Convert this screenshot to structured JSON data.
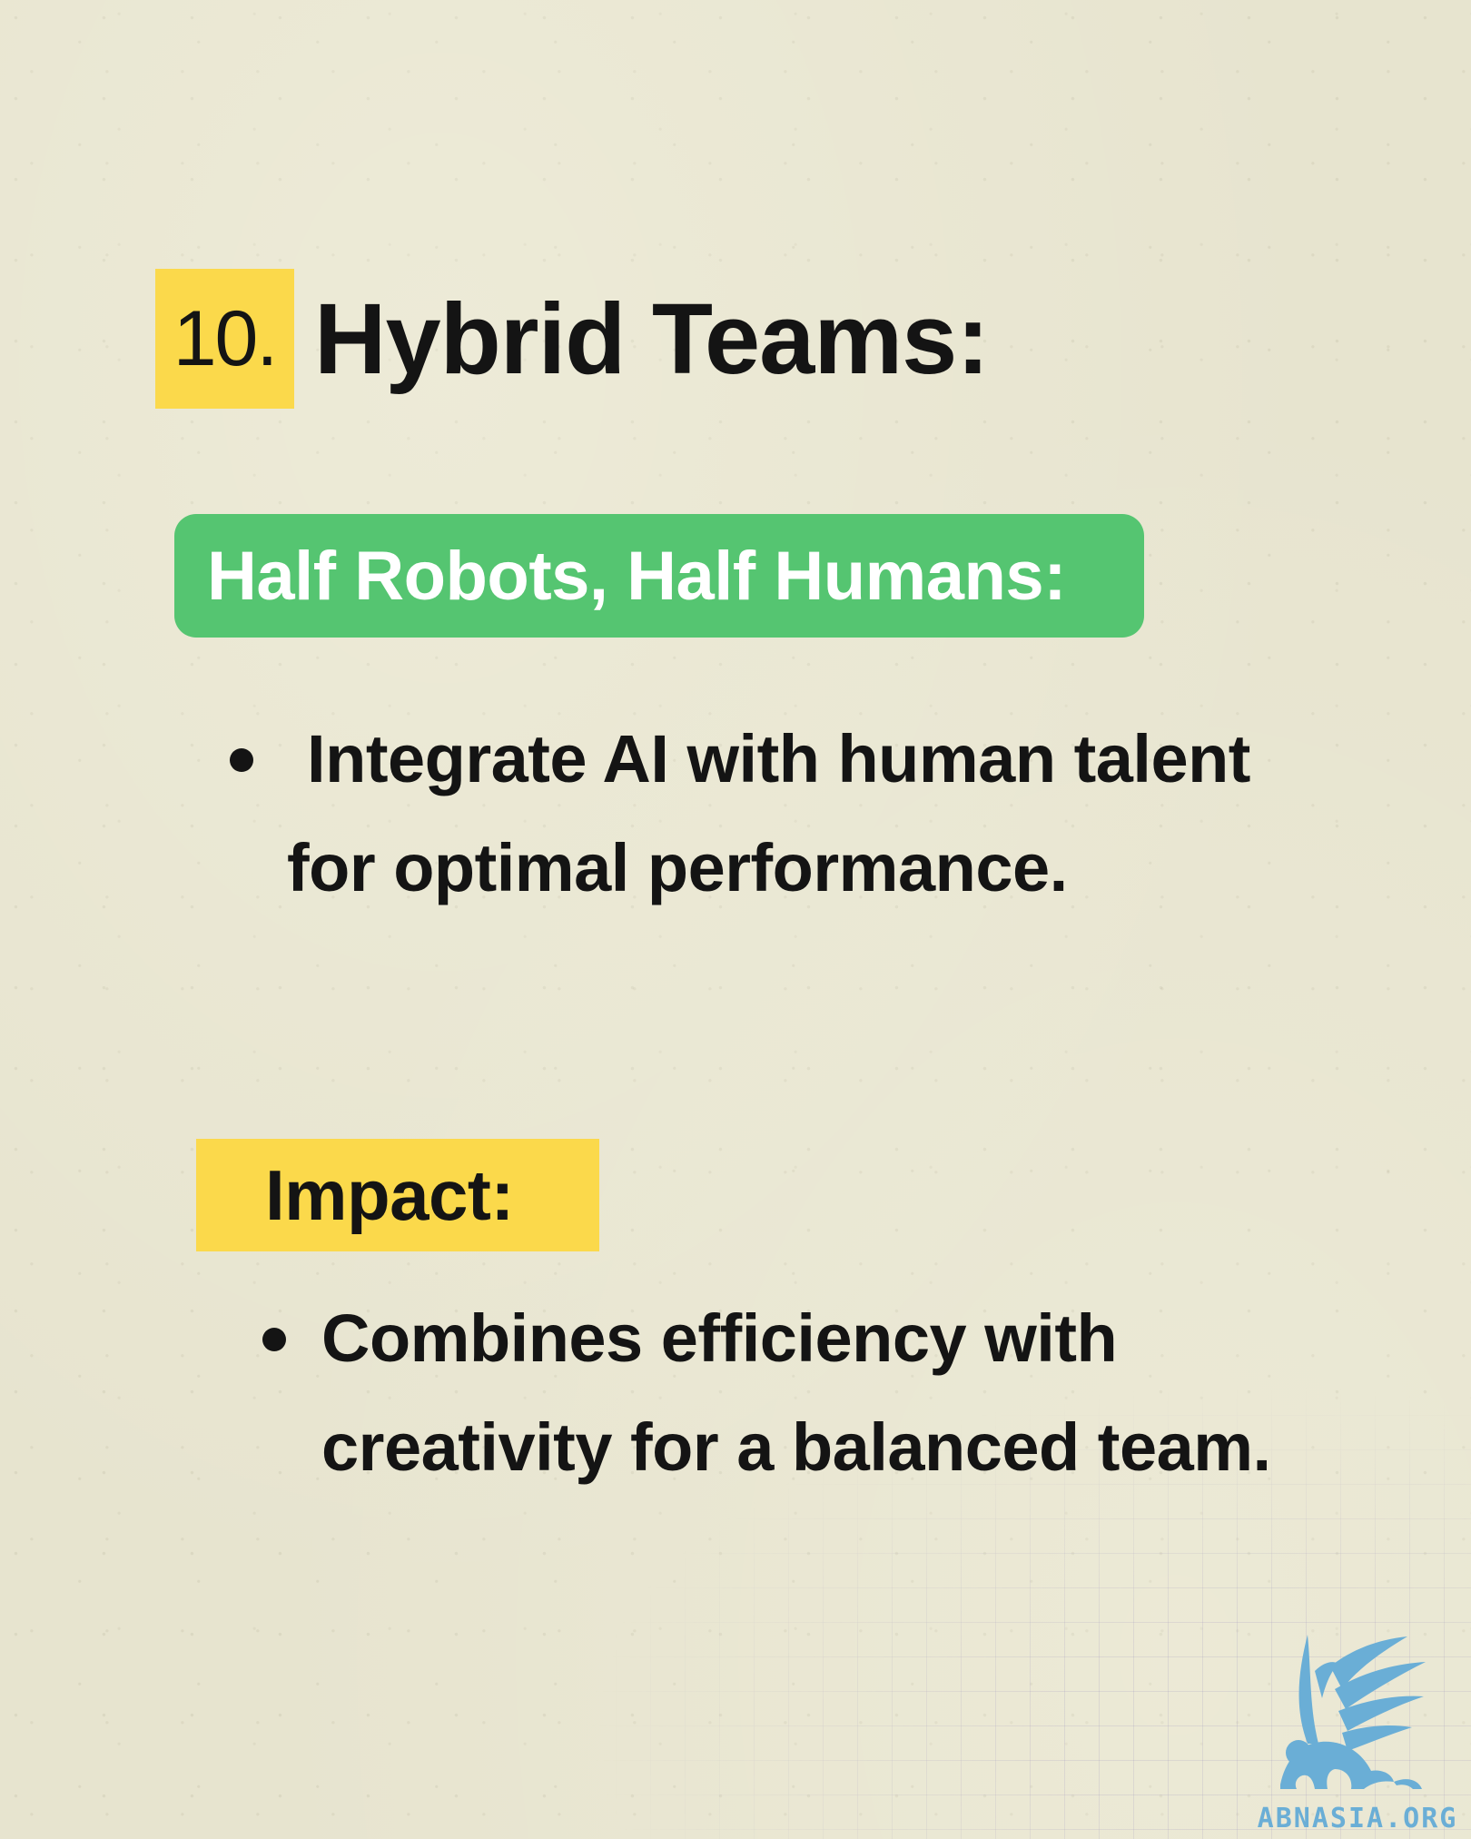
{
  "heading": {
    "number": "10.",
    "title": "Hybrid Teams:"
  },
  "subtitle": {
    "label": "Half Robots, Half Humans:"
  },
  "bullet_one": {
    "line1": " Integrate AI with human talent",
    "line2": "for optimal performance."
  },
  "impact": {
    "label": "Impact:"
  },
  "bullet_two": {
    "line1": "Combines efficiency with",
    "line2": "creativity for a balanced team."
  },
  "logo": {
    "text": "ABNASIA.ORG",
    "icon": "winged-lion-icon",
    "color": "#6aaed6"
  },
  "colors": {
    "background": "#e7e4cf",
    "yellow_highlight": "#fbd94b",
    "green_pill": "#55c571",
    "text": "#141414"
  }
}
